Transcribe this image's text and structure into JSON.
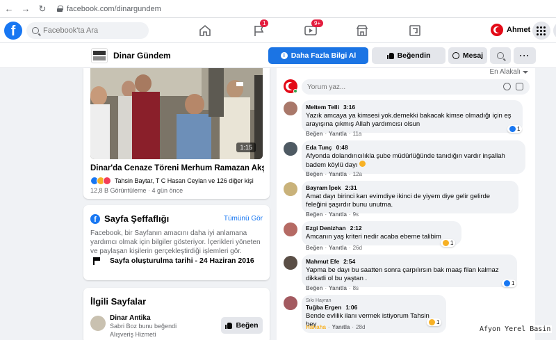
{
  "browser": {
    "url": "facebook.com/dinargundem"
  },
  "header": {
    "search_placeholder": "Facebook'ta Ara",
    "flag_badge": "1",
    "watch_badge": "9+",
    "profile_name": "Ahmet"
  },
  "page": {
    "name": "Dinar Gündem",
    "more_info_label": "Daha Fazla Bilgi Al",
    "liked_label": "Beğendin",
    "message_label": "Mesaj"
  },
  "video": {
    "duration": "1:15",
    "title": "Dinar'da Cenaze Töreni Merhum Ramazan Akşen...",
    "reactions": "Tahsin Baytar, T C Hasan Ceylan ve 126 diğer kişi",
    "meta": "12,8 B Görüntüleme · 4 gün önce"
  },
  "transparency": {
    "title": "Sayfa Şeffaflığı",
    "see_all": "Tümünü Gör",
    "body": "Facebook, bir Sayfanın amacını daha iyi anlamana yardımcı olmak için bilgiler gösteriyor. İçerikleri yöneten ve paylaşan kişilerin gerçekleştirdiği işlemleri gör.",
    "created": "Sayfa oluşturulma tarihi - 24 Haziran 2016"
  },
  "related": {
    "title": "İlgili Sayfalar",
    "page_name": "Dinar Antika",
    "liked_by": "Sabri Boz bunu beğendi",
    "category": "Alışveriş Hizmeti",
    "like_label": "Beğen"
  },
  "comments": {
    "sort_label": "En Alakalı",
    "compose_placeholder": "Yorum yaz...",
    "like_action": "Beğen",
    "reply_action": "Yanıtla",
    "items": [
      {
        "name": "Meltem Telli",
        "time": "3:16",
        "text_1": "Yazık amcaya ya kimsesi yok.demekki bakacak kimse olmadığı için eş",
        "text_2": "arayışına çıkmış Allah yardımcısı olsun",
        "ago": "11a",
        "react_count": "1",
        "avatar_color": "#a9786a"
      },
      {
        "name": "Eda Tunç",
        "time": "0:48",
        "text_1": "Afyonda dolandırıcılıkla şube müdürlüğünde tanıdığın vardır inşallah",
        "text_2": "badem köylü dayı",
        "ago": "12a",
        "avatar_color": "#4e5a63"
      },
      {
        "name": "Bayram İpek",
        "time": "2:31",
        "text_1": "Amat dayı birinci karı evimdiye ikinci de yiyem diye gelir gelirde",
        "text_2": "feleğini şaşırdır bunu unutma.",
        "ago": "9s",
        "avatar_color": "#c9b27a"
      },
      {
        "name": "Ezgi Denizhan",
        "time": "2:12",
        "text_1": "Amcanın yaş kriteri nedir acaba ebeme talibim",
        "text_2": "",
        "ago": "26d",
        "react_count": "1",
        "avatar_color": "#b56a64"
      },
      {
        "name": "Mahmut Efe",
        "time": "2:54",
        "text_1": "Yapma be dayı bu saatten sonra çarpılırsın bak maaş filan kalmaz",
        "text_2": "dikkatli ol bu yaştan .",
        "ago": "8s",
        "react_count": "1",
        "avatar_color": "#5a4e46"
      },
      {
        "name": "Tuğba Ergen",
        "time": "1:06",
        "badge": "Sıkı Hayran",
        "text_1": "Bende evlilik ilanı vermek istiyorum Tahsin bey",
        "text_2": "",
        "ago": "28d",
        "first_action": "Hahaha",
        "react_count": "1",
        "avatar_color": "#a35a60"
      }
    ]
  },
  "watermark": "Afyon Yerel Basin",
  "colors": {
    "brand_blue": "#1877f2",
    "primary_button": "#1b74e4",
    "badge_red": "#e41e3f"
  }
}
